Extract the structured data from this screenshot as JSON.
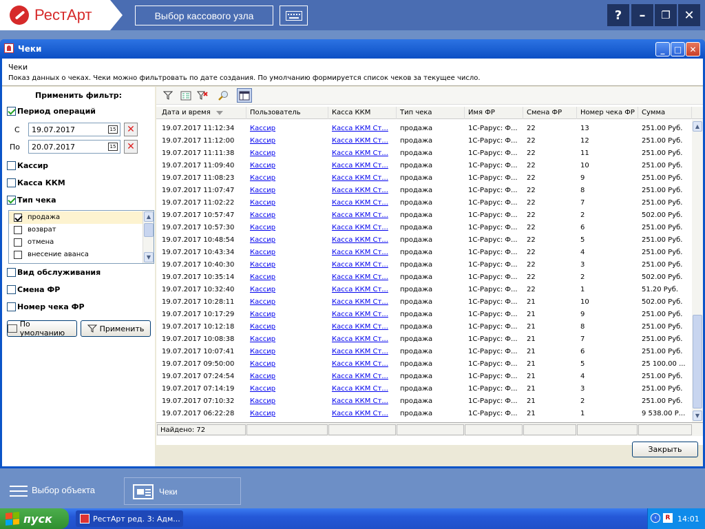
{
  "app": {
    "logo_text": "РестАрт",
    "cash_node_button": "Выбор кассового узла",
    "help_label": "?",
    "minimize_label": "–",
    "restore_label": "❐",
    "close_label": "✕"
  },
  "window": {
    "title": "Чеки",
    "description_title": "Чеки",
    "description_text": "Показ данных о чеках. Чеки можно фильтровать по дате создания. По умолчанию формируется список чеков за текущее число.",
    "close_button": "Закрыть"
  },
  "filter": {
    "header": "Применить фильтр:",
    "period_label": "Период операций",
    "from_label": "С",
    "from_value": "19.07.2017",
    "to_label": "По",
    "to_value": "20.07.2017",
    "cashier_label": "Кассир",
    "kkm_label": "Касса ККМ",
    "check_type_label": "Тип чека",
    "check_types": [
      {
        "label": "продажа",
        "checked": true
      },
      {
        "label": "возврат",
        "checked": false
      },
      {
        "label": "отмена",
        "checked": false
      },
      {
        "label": "внесение аванса",
        "checked": false
      }
    ],
    "service_type_label": "Вид обслуживания",
    "shift_label": "Смена ФР",
    "check_number_label": "Номер чека ФР",
    "default_button": "По умолчанию",
    "apply_button": "Применить"
  },
  "grid": {
    "columns": [
      "Дата и время",
      "Пользователь",
      "Касса ККМ",
      "Тип чека",
      "Имя ФР",
      "Смена ФР",
      "Номер чека ФР",
      "Сумма"
    ],
    "rows": [
      [
        "19.07.2017 11:12:34",
        "Кассир",
        "Касса ККМ Ст...",
        "продажа",
        "1С-Рарус: Ф...",
        "22",
        "13",
        "251.00 Руб."
      ],
      [
        "19.07.2017 11:12:00",
        "Кассир",
        "Касса ККМ Ст...",
        "продажа",
        "1С-Рарус: Ф...",
        "22",
        "12",
        "251.00 Руб."
      ],
      [
        "19.07.2017 11:11:38",
        "Кассир",
        "Касса ККМ Ст...",
        "продажа",
        "1С-Рарус: Ф...",
        "22",
        "11",
        "251.00 Руб."
      ],
      [
        "19.07.2017 11:09:40",
        "Кассир",
        "Касса ККМ Ст...",
        "продажа",
        "1С-Рарус: Ф...",
        "22",
        "10",
        "251.00 Руб."
      ],
      [
        "19.07.2017 11:08:23",
        "Кассир",
        "Касса ККМ Ст...",
        "продажа",
        "1С-Рарус: Ф...",
        "22",
        "9",
        "251.00 Руб."
      ],
      [
        "19.07.2017 11:07:47",
        "Кассир",
        "Касса ККМ Ст...",
        "продажа",
        "1С-Рарус: Ф...",
        "22",
        "8",
        "251.00 Руб."
      ],
      [
        "19.07.2017 11:02:22",
        "Кассир",
        "Касса ККМ Ст...",
        "продажа",
        "1С-Рарус: Ф...",
        "22",
        "7",
        "251.00 Руб."
      ],
      [
        "19.07.2017 10:57:47",
        "Кассир",
        "Касса ККМ Ст...",
        "продажа",
        "1С-Рарус: Ф...",
        "22",
        "2",
        "502.00 Руб."
      ],
      [
        "19.07.2017 10:57:30",
        "Кассир",
        "Касса ККМ Ст...",
        "продажа",
        "1С-Рарус: Ф...",
        "22",
        "6",
        "251.00 Руб."
      ],
      [
        "19.07.2017 10:48:54",
        "Кассир",
        "Касса ККМ Ст...",
        "продажа",
        "1С-Рарус: Ф...",
        "22",
        "5",
        "251.00 Руб."
      ],
      [
        "19.07.2017 10:43:34",
        "Кассир",
        "Касса ККМ Ст...",
        "продажа",
        "1С-Рарус: Ф...",
        "22",
        "4",
        "251.00 Руб."
      ],
      [
        "19.07.2017 10:40:30",
        "Кассир",
        "Касса ККМ Ст...",
        "продажа",
        "1С-Рарус: Ф...",
        "22",
        "3",
        "251.00 Руб."
      ],
      [
        "19.07.2017 10:35:14",
        "Кассир",
        "Касса ККМ Ст...",
        "продажа",
        "1С-Рарус: Ф...",
        "22",
        "2",
        "502.00 Руб."
      ],
      [
        "19.07.2017 10:32:40",
        "Кассир",
        "Касса ККМ Ст...",
        "продажа",
        "1С-Рарус: Ф...",
        "22",
        "1",
        "51.20 Руб."
      ],
      [
        "19.07.2017 10:28:11",
        "Кассир",
        "Касса ККМ Ст...",
        "продажа",
        "1С-Рарус: Ф...",
        "21",
        "10",
        "502.00 Руб."
      ],
      [
        "19.07.2017 10:17:29",
        "Кассир",
        "Касса ККМ Ст...",
        "продажа",
        "1С-Рарус: Ф...",
        "21",
        "9",
        "251.00 Руб."
      ],
      [
        "19.07.2017 10:12:18",
        "Кассир",
        "Касса ККМ Ст...",
        "продажа",
        "1С-Рарус: Ф...",
        "21",
        "8",
        "251.00 Руб."
      ],
      [
        "19.07.2017 10:08:38",
        "Кассир",
        "Касса ККМ Ст...",
        "продажа",
        "1С-Рарус: Ф...",
        "21",
        "7",
        "251.00 Руб."
      ],
      [
        "19.07.2017 10:07:41",
        "Кассир",
        "Касса ККМ Ст...",
        "продажа",
        "1С-Рарус: Ф...",
        "21",
        "6",
        "251.00 Руб."
      ],
      [
        "19.07.2017 09:50:00",
        "Кассир",
        "Касса ККМ Ст...",
        "продажа",
        "1С-Рарус: Ф...",
        "21",
        "5",
        "25 100.00 ..."
      ],
      [
        "19.07.2017 07:24:54",
        "Кассир",
        "Касса ККМ Ст...",
        "продажа",
        "1С-Рарус: Ф...",
        "21",
        "4",
        "251.00 Руб."
      ],
      [
        "19.07.2017 07:14:19",
        "Кассир",
        "Касса ККМ Ст...",
        "продажа",
        "1С-Рарус: Ф...",
        "21",
        "3",
        "251.00 Руб."
      ],
      [
        "19.07.2017 07:10:32",
        "Кассир",
        "Касса ККМ Ст...",
        "продажа",
        "1С-Рарус: Ф...",
        "21",
        "2",
        "251.00 Руб."
      ],
      [
        "19.07.2017 06:22:28",
        "Кассир",
        "Касса ККМ Ст...",
        "продажа",
        "1С-Рарус: Ф...",
        "21",
        "1",
        "9 538.00 Р..."
      ]
    ],
    "found_label": "Найдено: 72"
  },
  "objbar": {
    "select_label": "Выбор объекта",
    "tab_label": "Чеки"
  },
  "taskbar": {
    "start_label": "пуск",
    "task_label": "РестАрт ред. 3: Адм...",
    "clock": "14:01",
    "tray_chevron": "‹",
    "tray_icon_text": "R"
  },
  "icons": [
    "logo-icon",
    "keyboard-icon",
    "filter-icon",
    "filter-list-icon",
    "filter-clear-icon",
    "search-icon",
    "columns-icon",
    "calendar-icon",
    "clear-date-icon",
    "hamburger-icon",
    "document-icon",
    "windows-flag-icon"
  ]
}
